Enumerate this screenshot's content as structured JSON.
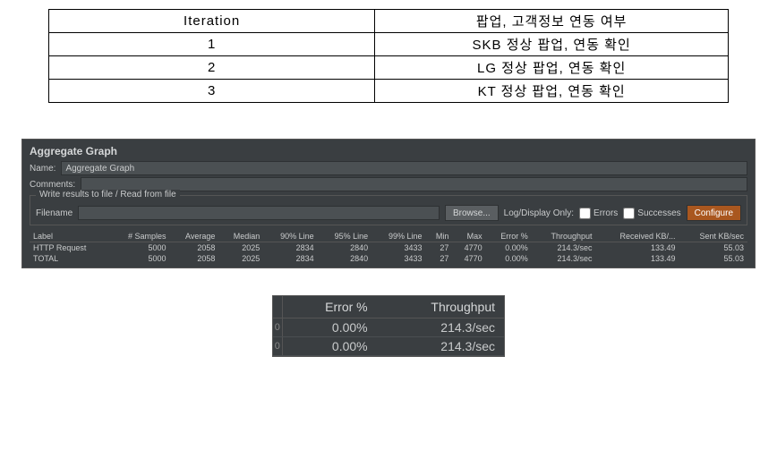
{
  "iteration_table": {
    "headers": [
      "Iteration",
      "팝업,  고객정보 연동 여부"
    ],
    "rows": [
      [
        "1",
        "SKB  정상 팝업,  연동 확인"
      ],
      [
        "2",
        "LG  정상 팝업,  연동 확인"
      ],
      [
        "3",
        "KT  정상 팝업,  연동 확인"
      ]
    ]
  },
  "jmeter": {
    "panel_title": "Aggregate Graph",
    "name_label": "Name:",
    "name_value": "Aggregate Graph",
    "comments_label": "Comments:",
    "comments_value": "",
    "fieldset_legend": "Write results to file / Read from file",
    "filename_label": "Filename",
    "filename_value": "",
    "browse_btn": "Browse...",
    "logdisplay_label": "Log/Display Only:",
    "errors_label": "Errors",
    "successes_label": "Successes",
    "configure_btn": "Configure",
    "columns": [
      "Label",
      "# Samples",
      "Average",
      "Median",
      "90% Line",
      "95% Line",
      "99% Line",
      "Min",
      "Max",
      "Error %",
      "Throughput",
      "Received KB/...",
      "Sent KB/sec"
    ],
    "rows": [
      [
        "HTTP Request",
        "5000",
        "2058",
        "2025",
        "2834",
        "2840",
        "3433",
        "27",
        "4770",
        "0.00%",
        "214.3/sec",
        "133.49",
        "55.03"
      ],
      [
        "TOTAL",
        "5000",
        "2058",
        "2025",
        "2834",
        "2840",
        "3433",
        "27",
        "4770",
        "0.00%",
        "214.3/sec",
        "133.49",
        "55.03"
      ]
    ]
  },
  "zoom": {
    "headers": [
      "Error %",
      "Throughput"
    ],
    "rows": [
      [
        "0",
        "0.00%",
        "214.3/sec"
      ],
      [
        "0",
        "0.00%",
        "214.3/sec"
      ]
    ]
  },
  "chart_data": {
    "type": "table",
    "title": "Aggregate Graph",
    "columns": [
      "Label",
      "# Samples",
      "Average",
      "Median",
      "90% Line",
      "95% Line",
      "99% Line",
      "Min",
      "Max",
      "Error %",
      "Throughput",
      "Received KB/sec",
      "Sent KB/sec"
    ],
    "rows": [
      [
        "HTTP Request",
        5000,
        2058,
        2025,
        2834,
        2840,
        3433,
        27,
        4770,
        0.0,
        214.3,
        133.49,
        55.03
      ],
      [
        "TOTAL",
        5000,
        2058,
        2025,
        2834,
        2840,
        3433,
        27,
        4770,
        0.0,
        214.3,
        133.49,
        55.03
      ]
    ]
  }
}
